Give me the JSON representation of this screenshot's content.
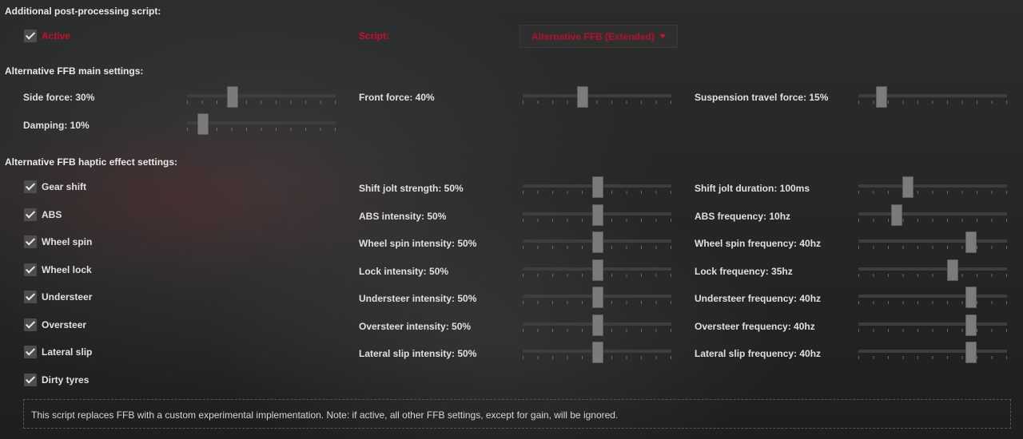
{
  "post_processing": {
    "title": "Additional post-processing script:",
    "active_label": "Active",
    "script_label": "Script:",
    "script_value": "Alternative FFB (Extended)"
  },
  "main_settings": {
    "title": "Alternative FFB main settings:",
    "side_force": {
      "label": "Side force: 30%",
      "value": 0.3
    },
    "front_force": {
      "label": "Front force: 40%",
      "value": 0.4
    },
    "suspension_travel_force": {
      "label": "Suspension travel force: 15%",
      "value": 0.15
    },
    "damping": {
      "label": "Damping: 10%",
      "value": 0.1
    }
  },
  "haptic_settings": {
    "title": "Alternative FFB haptic effect settings:",
    "effects": [
      {
        "name": "Gear shift",
        "checked": true
      },
      {
        "name": "ABS",
        "checked": true
      },
      {
        "name": "Wheel spin",
        "checked": true
      },
      {
        "name": "Wheel lock",
        "checked": true
      },
      {
        "name": "Understeer",
        "checked": true
      },
      {
        "name": "Oversteer",
        "checked": true
      },
      {
        "name": "Lateral slip",
        "checked": true
      },
      {
        "name": "Dirty tyres",
        "checked": true
      }
    ],
    "intensities": [
      {
        "label": "Shift jolt strength: 50%",
        "value": 0.5
      },
      {
        "label": "ABS intensity: 50%",
        "value": 0.5
      },
      {
        "label": "Wheel spin intensity: 50%",
        "value": 0.5
      },
      {
        "label": "Lock intensity: 50%",
        "value": 0.5
      },
      {
        "label": "Understeer intensity: 50%",
        "value": 0.5
      },
      {
        "label": "Oversteer intensity: 50%",
        "value": 0.5
      },
      {
        "label": "Lateral slip intensity: 50%",
        "value": 0.5
      }
    ],
    "frequencies": [
      {
        "label": "Shift jolt duration: 100ms",
        "value": 0.33
      },
      {
        "label": "ABS frequency: 10hz",
        "value": 0.25
      },
      {
        "label": "Wheel spin frequency: 40hz",
        "value": 0.75
      },
      {
        "label": "Lock frequency: 35hz",
        "value": 0.63
      },
      {
        "label": "Understeer frequency: 40hz",
        "value": 0.75
      },
      {
        "label": "Oversteer frequency: 40hz",
        "value": 0.75
      },
      {
        "label": "Lateral slip frequency: 40hz",
        "value": 0.75
      }
    ]
  },
  "note": "This script replaces FFB with a custom experimental implementation. Note: if active, all other FFB settings, except for gain, will be ignored.",
  "colors": {
    "accent": "#c8102e",
    "background": "#262827"
  }
}
